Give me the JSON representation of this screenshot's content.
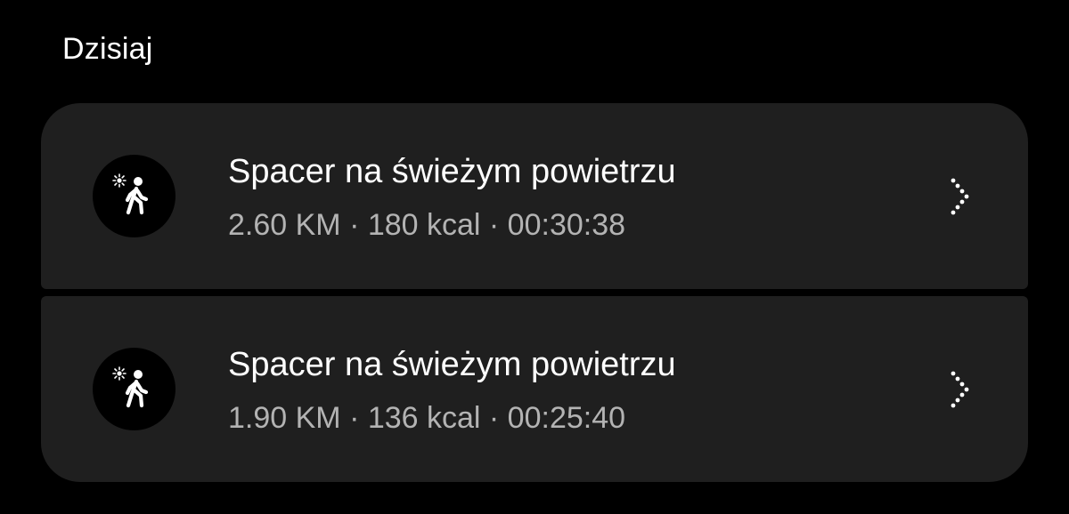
{
  "section": {
    "title": "Dzisiaj"
  },
  "activities": [
    {
      "title": "Spacer na świeżym powietrzu",
      "distance": "2.60 KM",
      "calories": "180 kcal",
      "duration": "00:30:38",
      "summary": "2.60 KM · 180 kcal · 00:30:38",
      "icon": "outdoor-walk-icon"
    },
    {
      "title": "Spacer na świeżym powietrzu",
      "distance": "1.90 KM",
      "calories": "136 kcal",
      "duration": "00:25:40",
      "summary": "1.90 KM · 136 kcal · 00:25:40",
      "icon": "outdoor-walk-icon"
    }
  ],
  "colors": {
    "background": "#000000",
    "card": "#1f1f1f",
    "primary_text": "#ffffff",
    "secondary_text": "#b3b3b3"
  }
}
